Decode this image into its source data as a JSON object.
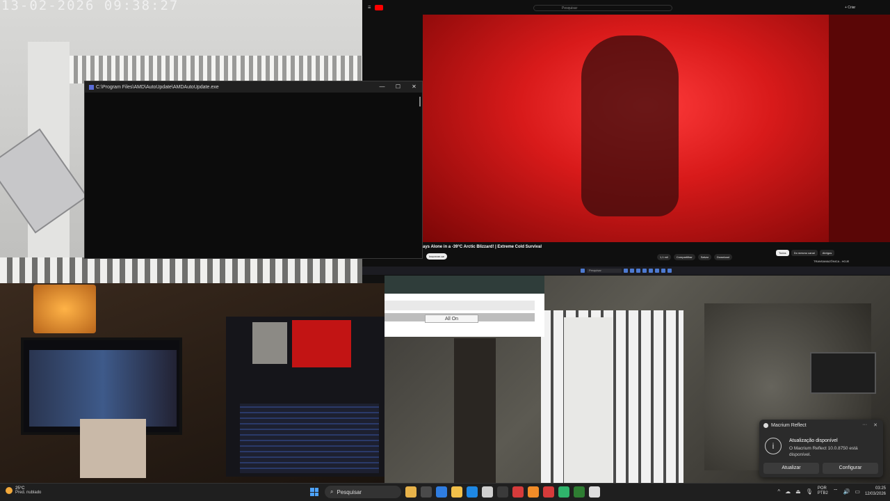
{
  "camera_top_left": {
    "timestamp": "13-02-2026 09:38:27"
  },
  "cmd_window": {
    "title": "C:\\Program Files\\AMD\\AutoUpdate\\AMDAutoUpdate.exe",
    "minimize": "—",
    "maximize": "☐",
    "close": "✕"
  },
  "youtube": {
    "search_placeholder": "Pesquisar",
    "create_label": "+ Criar",
    "video_title": "ays Alone in a -39°C Arctic Blizzard! | Extreme Cold Survival",
    "subscribe_label": "Inscrever-se",
    "actions": [
      "1,1 mil",
      "Compartilhar",
      "Salvar",
      "Download"
    ],
    "chips": [
      "Todos",
      "Do mesmo canal",
      "Abrigos"
    ],
    "recommended": "TRANSAMAZÔNICA - HOJE",
    "mini_taskbar_search": "Pesquisar"
  },
  "dialog": {
    "button_label": "All On"
  },
  "toast": {
    "app_name": "Macrium Reflect",
    "more": "···",
    "close": "✕",
    "title": "Atualização disponível",
    "body": "O Macrium Reflect 10.0.8750 está disponível.",
    "primary": "Atualizar",
    "secondary": "Configurar",
    "info_icon": "i"
  },
  "taskbar": {
    "weather_temp": "25°C",
    "weather_desc": "Pred. nublado",
    "search_label": "Pesquisar",
    "lang_top": "POR",
    "lang_bottom": "PTB2",
    "time": "03:25",
    "date": "12/03/2026",
    "tray_chevron": "^",
    "app_colors": [
      "#e8b34a",
      "#4a4a4a",
      "#2f7de1",
      "#f2c04a",
      "#1e88e5",
      "#cfcfcf",
      "#3a3a3a",
      "#d63b3b",
      "#f28c28",
      "#d63b3b",
      "#2fb36b",
      "#2e7d32",
      "#dddddd"
    ]
  }
}
